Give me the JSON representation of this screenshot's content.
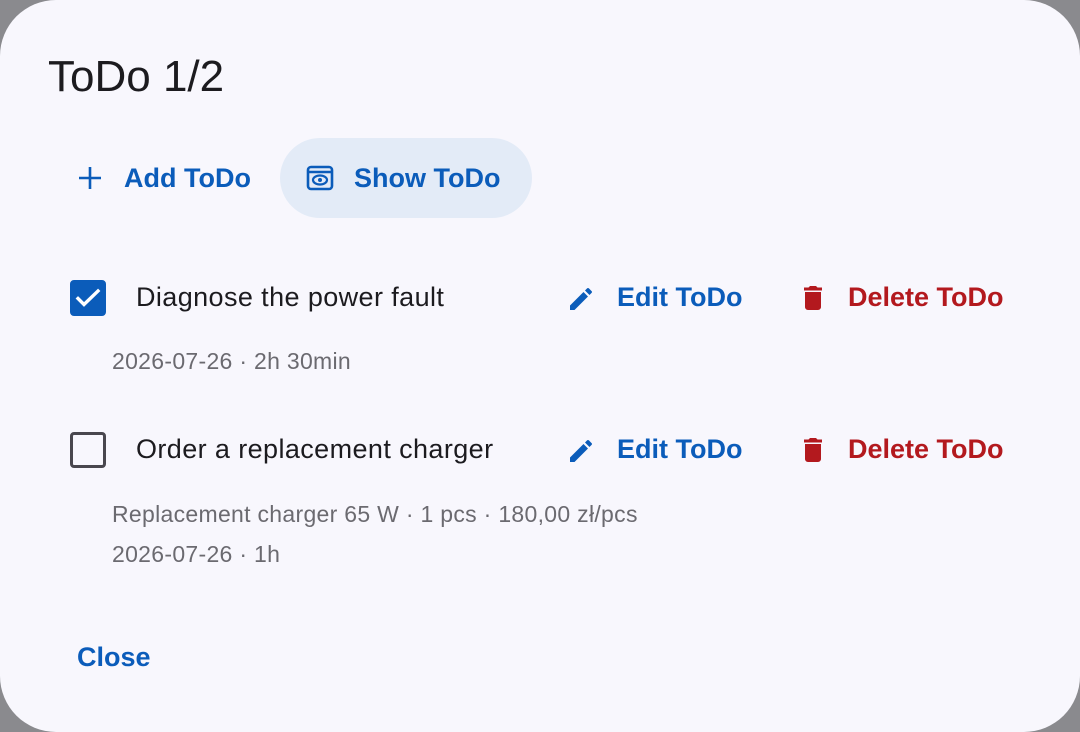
{
  "dialog": {
    "title": "ToDo 1/2",
    "actions": {
      "add_label": "Add ToDo",
      "show_label": "Show ToDo"
    },
    "todos": [
      {
        "label": "Diagnose the power fault",
        "checked": true,
        "meta_lines": [
          "2026-07-26 · 2h 30min"
        ],
        "edit_label": "Edit ToDo",
        "delete_label": "Delete ToDo"
      },
      {
        "label": "Order a replacement charger",
        "checked": false,
        "meta_lines": [
          "Replacement charger 65 W · 1 pcs · 180,00 zł/pcs",
          "2026-07-26 · 1h"
        ],
        "edit_label": "Edit ToDo",
        "delete_label": "Delete ToDo"
      }
    ],
    "close_label": "Close"
  },
  "colors": {
    "primary": "#0b5cba",
    "danger": "#b3191e",
    "surface": "#f8f7fd",
    "tonal": "#e3ebf7"
  }
}
